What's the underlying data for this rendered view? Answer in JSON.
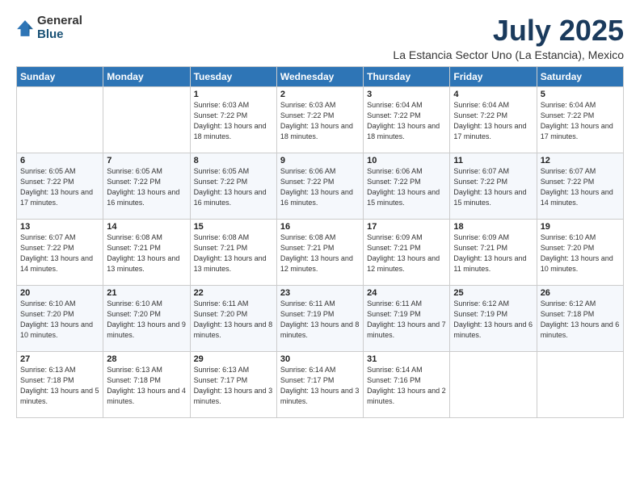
{
  "logo": {
    "general": "General",
    "blue": "Blue"
  },
  "title": "July 2025",
  "subtitle": "La Estancia Sector Uno (La Estancia), Mexico",
  "days_of_week": [
    "Sunday",
    "Monday",
    "Tuesday",
    "Wednesday",
    "Thursday",
    "Friday",
    "Saturday"
  ],
  "weeks": [
    [
      {
        "day": "",
        "info": ""
      },
      {
        "day": "",
        "info": ""
      },
      {
        "day": "1",
        "info": "Sunrise: 6:03 AM\nSunset: 7:22 PM\nDaylight: 13 hours and 18 minutes."
      },
      {
        "day": "2",
        "info": "Sunrise: 6:03 AM\nSunset: 7:22 PM\nDaylight: 13 hours and 18 minutes."
      },
      {
        "day": "3",
        "info": "Sunrise: 6:04 AM\nSunset: 7:22 PM\nDaylight: 13 hours and 18 minutes."
      },
      {
        "day": "4",
        "info": "Sunrise: 6:04 AM\nSunset: 7:22 PM\nDaylight: 13 hours and 17 minutes."
      },
      {
        "day": "5",
        "info": "Sunrise: 6:04 AM\nSunset: 7:22 PM\nDaylight: 13 hours and 17 minutes."
      }
    ],
    [
      {
        "day": "6",
        "info": "Sunrise: 6:05 AM\nSunset: 7:22 PM\nDaylight: 13 hours and 17 minutes."
      },
      {
        "day": "7",
        "info": "Sunrise: 6:05 AM\nSunset: 7:22 PM\nDaylight: 13 hours and 16 minutes."
      },
      {
        "day": "8",
        "info": "Sunrise: 6:05 AM\nSunset: 7:22 PM\nDaylight: 13 hours and 16 minutes."
      },
      {
        "day": "9",
        "info": "Sunrise: 6:06 AM\nSunset: 7:22 PM\nDaylight: 13 hours and 16 minutes."
      },
      {
        "day": "10",
        "info": "Sunrise: 6:06 AM\nSunset: 7:22 PM\nDaylight: 13 hours and 15 minutes."
      },
      {
        "day": "11",
        "info": "Sunrise: 6:07 AM\nSunset: 7:22 PM\nDaylight: 13 hours and 15 minutes."
      },
      {
        "day": "12",
        "info": "Sunrise: 6:07 AM\nSunset: 7:22 PM\nDaylight: 13 hours and 14 minutes."
      }
    ],
    [
      {
        "day": "13",
        "info": "Sunrise: 6:07 AM\nSunset: 7:22 PM\nDaylight: 13 hours and 14 minutes."
      },
      {
        "day": "14",
        "info": "Sunrise: 6:08 AM\nSunset: 7:21 PM\nDaylight: 13 hours and 13 minutes."
      },
      {
        "day": "15",
        "info": "Sunrise: 6:08 AM\nSunset: 7:21 PM\nDaylight: 13 hours and 13 minutes."
      },
      {
        "day": "16",
        "info": "Sunrise: 6:08 AM\nSunset: 7:21 PM\nDaylight: 13 hours and 12 minutes."
      },
      {
        "day": "17",
        "info": "Sunrise: 6:09 AM\nSunset: 7:21 PM\nDaylight: 13 hours and 12 minutes."
      },
      {
        "day": "18",
        "info": "Sunrise: 6:09 AM\nSunset: 7:21 PM\nDaylight: 13 hours and 11 minutes."
      },
      {
        "day": "19",
        "info": "Sunrise: 6:10 AM\nSunset: 7:20 PM\nDaylight: 13 hours and 10 minutes."
      }
    ],
    [
      {
        "day": "20",
        "info": "Sunrise: 6:10 AM\nSunset: 7:20 PM\nDaylight: 13 hours and 10 minutes."
      },
      {
        "day": "21",
        "info": "Sunrise: 6:10 AM\nSunset: 7:20 PM\nDaylight: 13 hours and 9 minutes."
      },
      {
        "day": "22",
        "info": "Sunrise: 6:11 AM\nSunset: 7:20 PM\nDaylight: 13 hours and 8 minutes."
      },
      {
        "day": "23",
        "info": "Sunrise: 6:11 AM\nSunset: 7:19 PM\nDaylight: 13 hours and 8 minutes."
      },
      {
        "day": "24",
        "info": "Sunrise: 6:11 AM\nSunset: 7:19 PM\nDaylight: 13 hours and 7 minutes."
      },
      {
        "day": "25",
        "info": "Sunrise: 6:12 AM\nSunset: 7:19 PM\nDaylight: 13 hours and 6 minutes."
      },
      {
        "day": "26",
        "info": "Sunrise: 6:12 AM\nSunset: 7:18 PM\nDaylight: 13 hours and 6 minutes."
      }
    ],
    [
      {
        "day": "27",
        "info": "Sunrise: 6:13 AM\nSunset: 7:18 PM\nDaylight: 13 hours and 5 minutes."
      },
      {
        "day": "28",
        "info": "Sunrise: 6:13 AM\nSunset: 7:18 PM\nDaylight: 13 hours and 4 minutes."
      },
      {
        "day": "29",
        "info": "Sunrise: 6:13 AM\nSunset: 7:17 PM\nDaylight: 13 hours and 3 minutes."
      },
      {
        "day": "30",
        "info": "Sunrise: 6:14 AM\nSunset: 7:17 PM\nDaylight: 13 hours and 3 minutes."
      },
      {
        "day": "31",
        "info": "Sunrise: 6:14 AM\nSunset: 7:16 PM\nDaylight: 13 hours and 2 minutes."
      },
      {
        "day": "",
        "info": ""
      },
      {
        "day": "",
        "info": ""
      }
    ]
  ]
}
